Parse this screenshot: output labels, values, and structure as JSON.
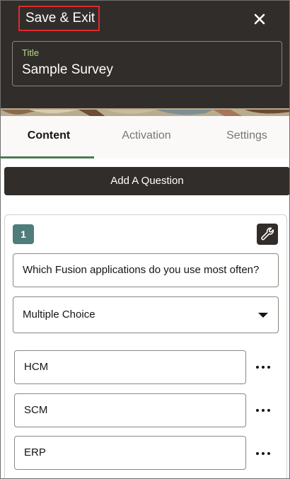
{
  "header": {
    "save_exit_label": "Save & Exit",
    "title_label": "Title",
    "title_value": "Sample Survey"
  },
  "tabs": [
    {
      "label": "Content",
      "active": true
    },
    {
      "label": "Activation",
      "active": false
    },
    {
      "label": "Settings",
      "active": false
    }
  ],
  "add_question_label": "Add A Question",
  "question": {
    "number": "1",
    "text": "Which Fusion applications do you use most often?",
    "type": "Multiple Choice",
    "choices": [
      "HCM",
      "SCM",
      "ERP"
    ]
  },
  "colors": {
    "header_bg": "#312d2a",
    "save_exit_highlight": "#e0292b",
    "active_tab_underline": "#4b7a51",
    "number_badge": "#4e7d7a",
    "title_label": "#b9d98a"
  },
  "icons": [
    "close-icon",
    "wrench-icon",
    "chevron-down-icon",
    "more-options-icon"
  ]
}
